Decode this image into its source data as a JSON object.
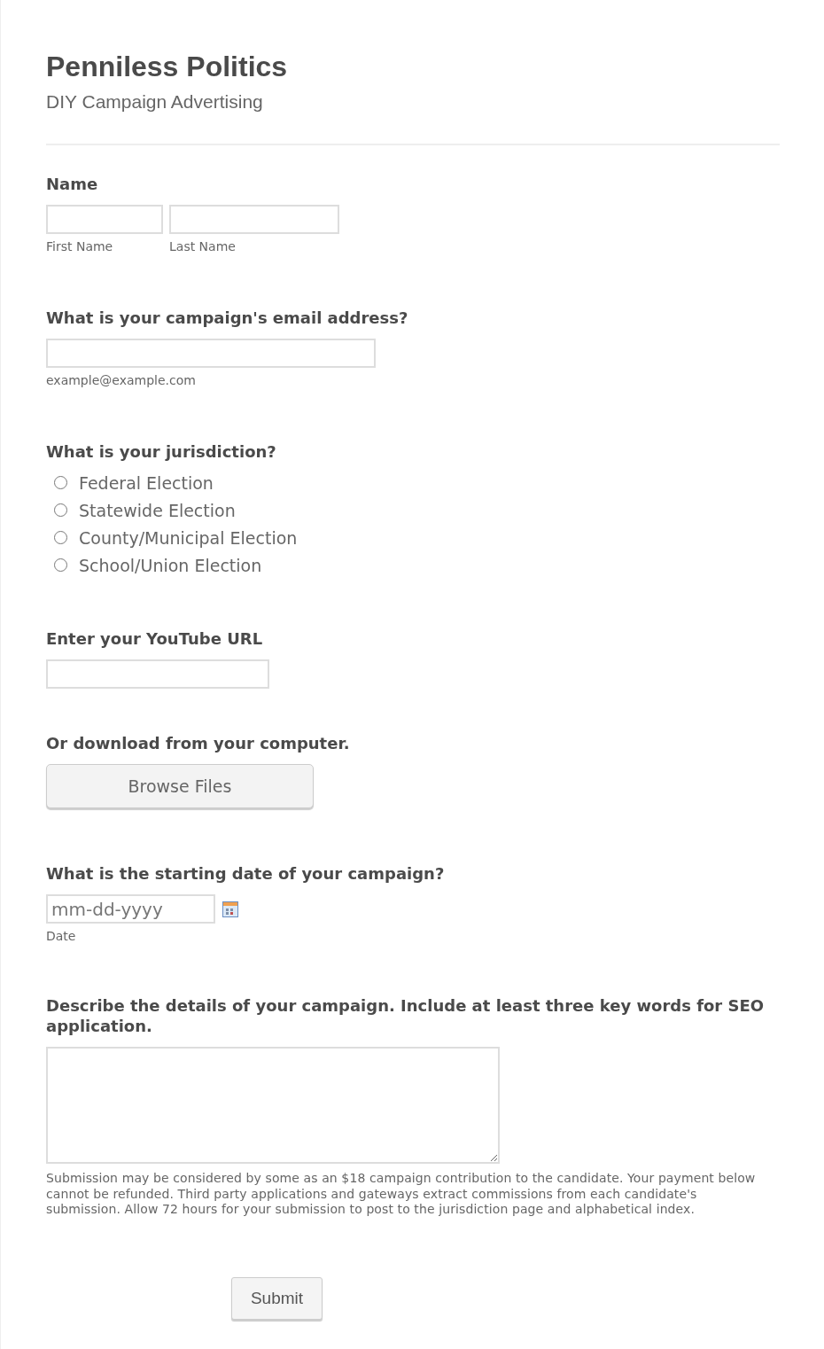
{
  "header": {
    "title": "Penniless Politics",
    "subtitle": "DIY Campaign Advertising"
  },
  "fields": [
    {
      "kind": "name",
      "label": "Name",
      "sublabels": [
        "First Name",
        "Last Name"
      ]
    },
    {
      "kind": "email",
      "label": "What is your campaign's email address?",
      "hint": "example@example.com"
    },
    {
      "kind": "radio",
      "label": "What is your jurisdiction?",
      "options": [
        {
          "label": "Federal Election",
          "selected": false
        },
        {
          "label": "Statewide Election",
          "selected": false
        },
        {
          "label": "County/Municipal Election",
          "selected": false
        },
        {
          "label": "School/Union Election",
          "selected": false
        }
      ]
    },
    {
      "kind": "text",
      "label": "Enter your YouTube URL"
    },
    {
      "kind": "upload",
      "label": "Or download from your computer.",
      "button": "Browse Files"
    },
    {
      "kind": "date",
      "label": "What is the starting date of your campaign?",
      "placeholder": "mm-dd-yyyy",
      "hint": "Date"
    },
    {
      "kind": "textarea",
      "label": "Describe the details of your campaign. Include at least three key words for SEO application.",
      "hint": "Submission may be considered by some as an $18 campaign contribution to the candidate. Your payment below cannot be refunded. Third party applications and gateways extract commissions from each candidate's submission. Allow 72 hours for your submission to post to the jurisdiction page and alphabetical index."
    }
  ],
  "submit": "Submit"
}
